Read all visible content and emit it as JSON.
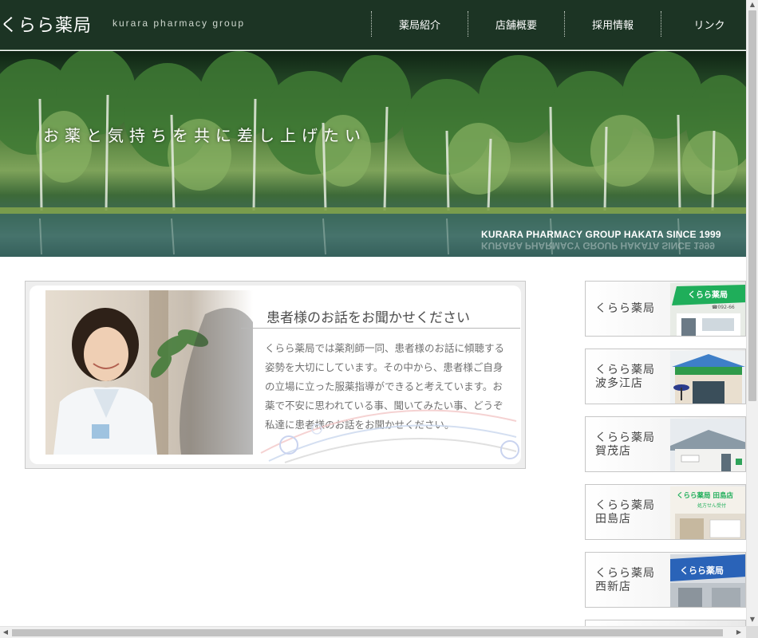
{
  "header": {
    "logo": "くらら薬局",
    "logo_sub": "kurara pharmacy group",
    "nav": [
      "薬局紹介",
      "店舗概要",
      "採用情報",
      "リンク"
    ]
  },
  "hero": {
    "tagline": "お薬と気持ちを共に差し上げたい",
    "caption": "KURARA PHARMACY GROUP HAKATA SINCE 1999"
  },
  "message": {
    "title": "患者様のお話をお聞かせください",
    "body": "くらら薬局では薬剤師一同、患者様のお話に傾聴する姿勢を大切にしています。その中から、患者様ご自身の立場に立った服薬指導ができると考えています。お薬で不安に思われている事、聞いてみたい事、どうぞ私達に患者様のお話をお聞かせください。"
  },
  "stores": [
    {
      "line1": "くらら薬局",
      "line2": "",
      "sign": "くらら薬局",
      "sign_sub": "☎092-66"
    },
    {
      "line1": "くらら薬局",
      "line2": "波多江店"
    },
    {
      "line1": "くらら薬局",
      "line2": "賀茂店"
    },
    {
      "line1": "くらら薬局",
      "line2": "田島店",
      "sign": "くらら薬局 田島店",
      "sign_sub": "処方せん受付"
    },
    {
      "line1": "くらら薬局",
      "line2": "西新店",
      "sign": "くらら薬局"
    }
  ],
  "colors": {
    "header_bg": "#1c3424",
    "store_sign_green": "#1fae5a",
    "store_sign_blue": "#2a63b8"
  },
  "icons": {
    "scroll_up": "▲",
    "scroll_down": "▼",
    "scroll_left": "◀",
    "scroll_right": "▶"
  }
}
